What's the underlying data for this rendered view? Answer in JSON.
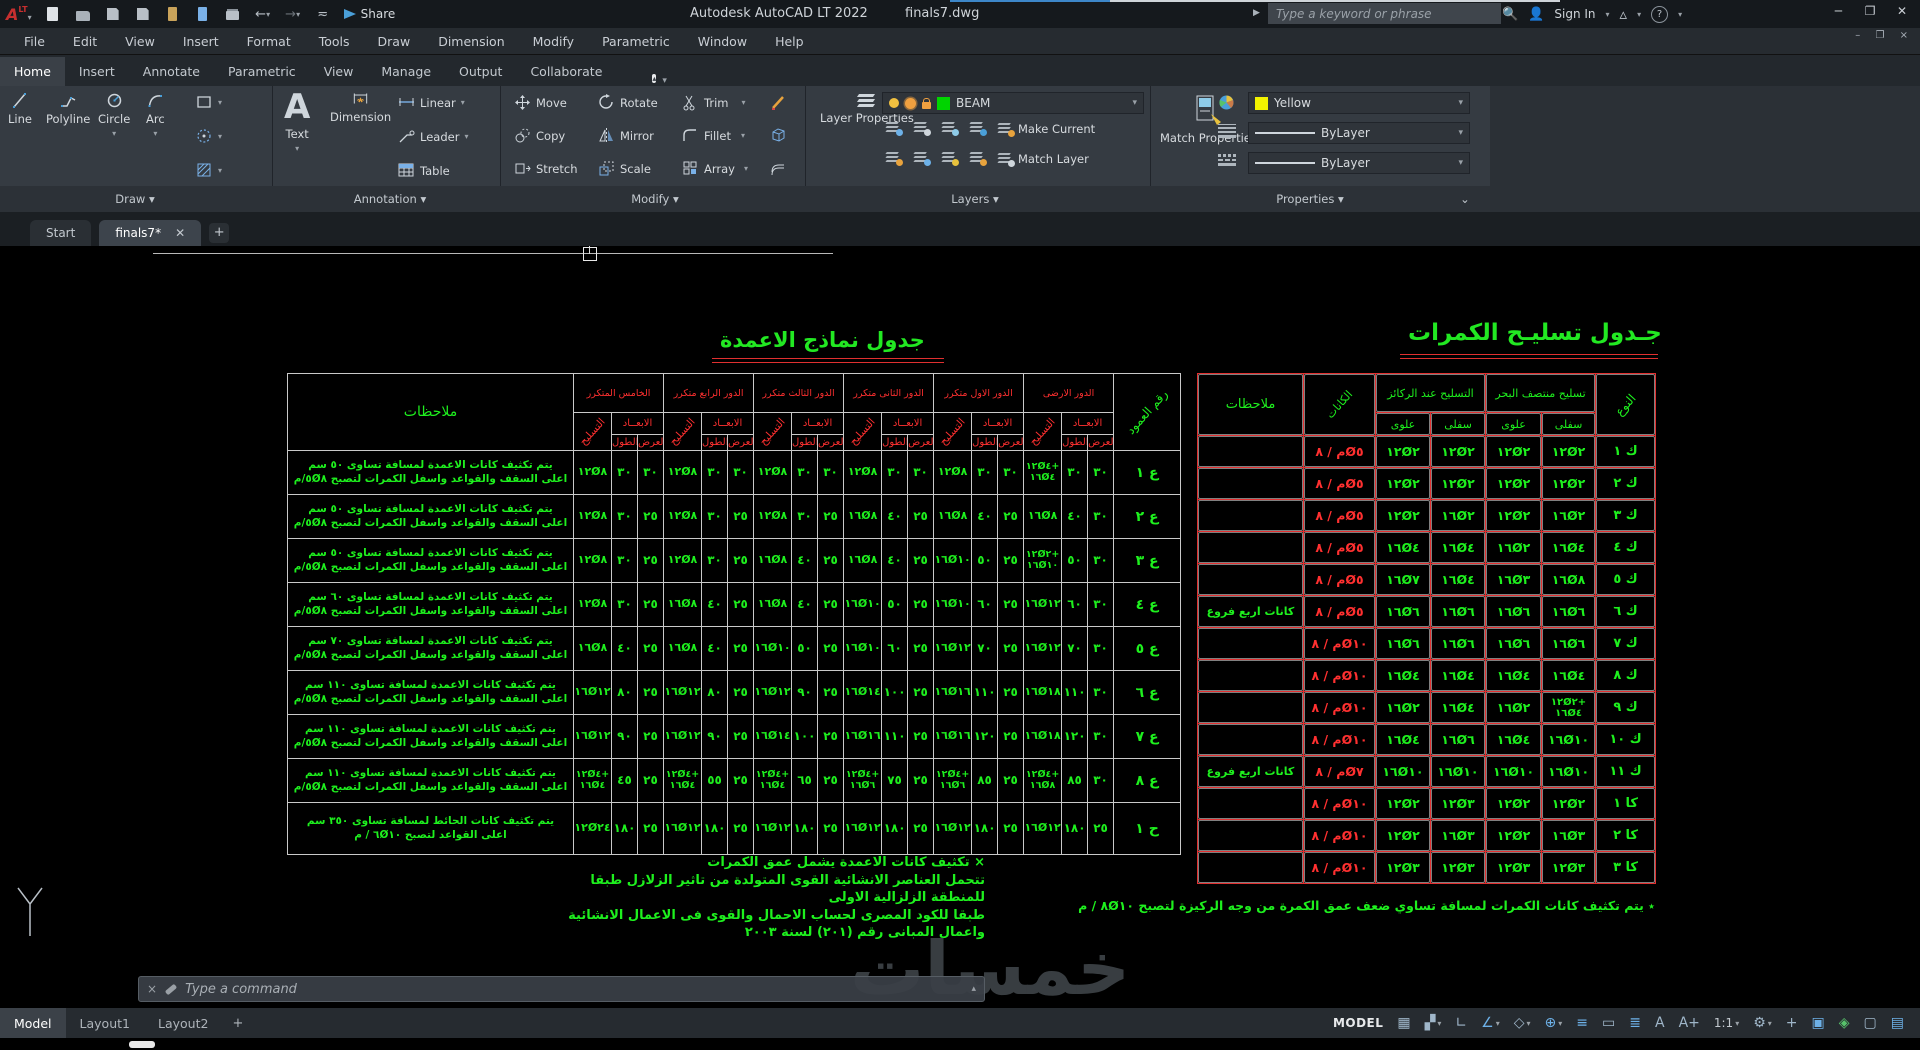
{
  "app": {
    "title": "Autodesk AutoCAD LT 2022",
    "file": "finals7.dwg",
    "share": "Share",
    "search_placeholder": "Type a keyword or phrase",
    "sign_in": "Sign In",
    "logo": "A",
    "logo_lt": "LT"
  },
  "menu": [
    "File",
    "Edit",
    "View",
    "Insert",
    "Format",
    "Tools",
    "Draw",
    "Dimension",
    "Modify",
    "Parametric",
    "Window",
    "Help"
  ],
  "ribbon_tabs": [
    {
      "label": "Home",
      "active": true
    },
    {
      "label": "Insert",
      "active": false
    },
    {
      "label": "Annotate",
      "active": false
    },
    {
      "label": "Parametric",
      "active": false
    },
    {
      "label": "View",
      "active": false
    },
    {
      "label": "Manage",
      "active": false
    },
    {
      "label": "Output",
      "active": false
    },
    {
      "label": "Collaborate",
      "active": false
    }
  ],
  "panels": {
    "draw": {
      "label": "Draw",
      "line": "Line",
      "polyline": "Polyline",
      "circle": "Circle",
      "arc": "Arc"
    },
    "annotation": {
      "label": "Annotation",
      "text": "Text",
      "dimension": "Dimension",
      "linear": "Linear",
      "leader": "Leader",
      "table": "Table"
    },
    "modify": {
      "label": "Modify",
      "move": "Move",
      "rotate": "Rotate",
      "trim": "Trim",
      "copy": "Copy",
      "mirror": "Mirror",
      "fillet": "Fillet",
      "stretch": "Stretch",
      "scale": "Scale",
      "array": "Array"
    },
    "layers": {
      "label": "Layers",
      "layer_properties": "Layer Properties",
      "layer_name": "BEAM",
      "layer_color": "#00d400",
      "make_current": "Make Current",
      "match_layer": "Match Layer"
    },
    "properties": {
      "label": "Properties",
      "match_properties": "Match Properties",
      "color_name": "Yellow",
      "color_hex": "#f2f200",
      "lineweight": "ByLayer",
      "linetype": "ByLayer"
    }
  },
  "file_tabs": [
    {
      "label": "Start",
      "active": false,
      "closable": false
    },
    {
      "label": "finals7*",
      "active": true,
      "closable": true
    }
  ],
  "new_tab_label": "+",
  "left_table": {
    "title": "جدول نماذج الاعمدة",
    "headers": {
      "notes": "ملاحظات",
      "col_no": "رقم العمود",
      "dims": "الابعــاد",
      "length": "الطول",
      "width": "العرض",
      "reinf": "التسليح",
      "floors": [
        "الدور الارضى",
        "الدور الاول متكرر",
        "الدور الثانى متكرر",
        "الدور الثالث متكرر",
        "الدور الرابع متكرر",
        "الخامس المتكرر"
      ]
    },
    "rows": [
      {
        "id": "ع ١",
        "floors": [
          {
            "w": "٣٠",
            "l": "٣٠",
            "r": "١٢Ø٤+|١٦Ø٤"
          },
          {
            "w": "٣٠",
            "l": "٣٠",
            "r": "١٢Ø٨"
          },
          {
            "w": "٣٠",
            "l": "٣٠",
            "r": "١٢Ø٨"
          },
          {
            "w": "٣٠",
            "l": "٣٠",
            "r": "١٢Ø٨"
          },
          {
            "w": "٣٠",
            "l": "٣٠",
            "r": "١٢Ø٨"
          },
          {
            "w": "٣٠",
            "l": "٣٠",
            "r": "١٢Ø٨"
          }
        ],
        "note": [
          "يتم تكثيف كانات الاعمدة لمسافة تساوى ٥٠ سم",
          "اعلى السقف والقواعد واسفل الكمرات لتصبح ٥Ø٨/م"
        ]
      },
      {
        "id": "ع ٢",
        "floors": [
          {
            "w": "٣٠",
            "l": "٤٠",
            "r": "١٦Ø٨"
          },
          {
            "w": "٢٥",
            "l": "٤٠",
            "r": "١٦Ø٨"
          },
          {
            "w": "٢٥",
            "l": "٤٠",
            "r": "١٦Ø٨"
          },
          {
            "w": "٢٥",
            "l": "٣٠",
            "r": "١٢Ø٨"
          },
          {
            "w": "٢٥",
            "l": "٣٠",
            "r": "١٢Ø٨"
          },
          {
            "w": "٢٥",
            "l": "٣٠",
            "r": "١٢Ø٨"
          }
        ],
        "note": [
          "يتم تكثيف كانات الاعمدة لمسافة تساوى ٥٠ سم",
          "اعلى السقف والقواعد واسفل الكمرات لتصبح ٥Ø٨/م"
        ]
      },
      {
        "id": "ع ٣",
        "floors": [
          {
            "w": "٣٠",
            "l": "٥٠",
            "r": "١٢Ø٢+|١٦Ø١٠"
          },
          {
            "w": "٢٥",
            "l": "٥٠",
            "r": "١٦Ø١٠"
          },
          {
            "w": "٢٥",
            "l": "٤٠",
            "r": "١٦Ø٨"
          },
          {
            "w": "٢٥",
            "l": "٤٠",
            "r": "١٦Ø٨"
          },
          {
            "w": "٢٥",
            "l": "٣٠",
            "r": "١٢Ø٨"
          },
          {
            "w": "٢٥",
            "l": "٣٠",
            "r": "١٢Ø٨"
          }
        ],
        "note": [
          "يتم تكثيف كانات الاعمدة لمسافة تساوى ٥٠ سم",
          "اعلى السقف والقواعد واسفل الكمرات لتصبح ٥Ø٨/م"
        ]
      },
      {
        "id": "ع ٤",
        "floors": [
          {
            "w": "٣٠",
            "l": "٦٠",
            "r": "١٦Ø١٢"
          },
          {
            "w": "٢٥",
            "l": "٦٠",
            "r": "١٦Ø١٠"
          },
          {
            "w": "٢٥",
            "l": "٥٠",
            "r": "١٦Ø١٠"
          },
          {
            "w": "٢٥",
            "l": "٤٠",
            "r": "١٦Ø٨"
          },
          {
            "w": "٢٥",
            "l": "٤٠",
            "r": "١٦Ø٨"
          },
          {
            "w": "٢٥",
            "l": "٣٠",
            "r": "١٢Ø٨"
          }
        ],
        "note": [
          "يتم تكثيف كانات الاعمدة لمسافة تساوى ٦٠ سم",
          "اعلى السقف والقواعد واسفل الكمرات لتصبح ٥Ø٨/م"
        ]
      },
      {
        "id": "ع ٥",
        "floors": [
          {
            "w": "٣٠",
            "l": "٧٠",
            "r": "١٦Ø١٢"
          },
          {
            "w": "٢٥",
            "l": "٧٠",
            "r": "١٦Ø١٢"
          },
          {
            "w": "٢٥",
            "l": "٦٠",
            "r": "١٦Ø١٠"
          },
          {
            "w": "٢٥",
            "l": "٥٠",
            "r": "١٦Ø١٠"
          },
          {
            "w": "٢٥",
            "l": "٤٠",
            "r": "١٦Ø٨"
          },
          {
            "w": "٢٥",
            "l": "٤٠",
            "r": "١٦Ø٨"
          }
        ],
        "note": [
          "يتم تكثيف كانات الاعمدة لمسافة تساوى ٧٠ سم",
          "اعلى السقف والقواعد واسفل الكمرات لتصبح ٥Ø٨/م"
        ]
      },
      {
        "id": "ع ٦",
        "floors": [
          {
            "w": "٣٠",
            "l": "١١٠",
            "r": "١٦Ø١٨"
          },
          {
            "w": "٢٥",
            "l": "١١٠",
            "r": "١٦Ø١٦"
          },
          {
            "w": "٢٥",
            "l": "١٠٠",
            "r": "١٦Ø١٤"
          },
          {
            "w": "٢٥",
            "l": "٩٠",
            "r": "١٦Ø١٢"
          },
          {
            "w": "٢٥",
            "l": "٨٠",
            "r": "١٦Ø١٢"
          },
          {
            "w": "٢٥",
            "l": "٨٠",
            "r": "١٦Ø١٢"
          }
        ],
        "note": [
          "يتم تكثيف كانات الاعمدة لمسافة تساوى ١١٠ سم",
          "اعلى السقف والقواعد واسفل الكمرات لتصبح ٥Ø٨/م"
        ]
      },
      {
        "id": "ع ٧",
        "floors": [
          {
            "w": "٣٠",
            "l": "١٢٠",
            "r": "١٦Ø١٨"
          },
          {
            "w": "٢٥",
            "l": "١٢٠",
            "r": "١٦Ø١٦"
          },
          {
            "w": "٢٥",
            "l": "١١٠",
            "r": "١٦Ø١٦"
          },
          {
            "w": "٢٥",
            "l": "١٠٠",
            "r": "١٦Ø١٤"
          },
          {
            "w": "٢٥",
            "l": "٩٠",
            "r": "١٦Ø١٢"
          },
          {
            "w": "٢٥",
            "l": "٩٠",
            "r": "١٦Ø١٢"
          }
        ],
        "note": [
          "يتم تكثيف كانات الاعمدة لمسافة تساوى ١١٠ سم",
          "اعلى السقف والقواعد واسفل الكمرات لتصبح ٥Ø٨/م"
        ]
      },
      {
        "id": "ع ٨",
        "floors": [
          {
            "w": "٣٠",
            "l": "٨٥",
            "r": "١٢Ø٤+|١٦Ø٨"
          },
          {
            "w": "٢٥",
            "l": "٨٥",
            "r": "١٢Ø٤+|١٦Ø٦"
          },
          {
            "w": "٢٥",
            "l": "٧٥",
            "r": "١٢Ø٤+|١٦Ø٦"
          },
          {
            "w": "٢٥",
            "l": "٦٥",
            "r": "١٢Ø٤+|١٦Ø٤"
          },
          {
            "w": "٢٥",
            "l": "٥٥",
            "r": "١٢Ø٤+|١٦Ø٤"
          },
          {
            "w": "٢٥",
            "l": "٤٥",
            "r": "١٢Ø٤+|١٦Ø٤"
          }
        ],
        "note": [
          "يتم تكثيف كانات الاعمدة لمسافة تساوى ١١٠ سم",
          "اعلى السقف والقواعد واسفل الكمرات لتصبح ٥Ø٨/م"
        ]
      },
      {
        "id": "ح ١",
        "floors": [
          {
            "w": "٢٥",
            "l": "١٨٠",
            "r": "١٦Ø١٢"
          },
          {
            "w": "٢٥",
            "l": "١٨٠",
            "r": "١٦Ø١٢"
          },
          {
            "w": "٢٥",
            "l": "١٨٠",
            "r": "١٦Ø١٢"
          },
          {
            "w": "٢٥",
            "l": "١٨٠",
            "r": "١٦Ø١٢"
          },
          {
            "w": "٢٥",
            "l": "١٨٠",
            "r": "١٦Ø١٢"
          },
          {
            "w": "٢٥",
            "l": "١٨٠",
            "r": "١٢Ø٢٤"
          }
        ],
        "note": [
          "يتم تكثيف كانات الحائط لمسافة تساوى ٣٥٠ سم",
          "اعلى القواعد لتصبح ٦Ø١٠ / م"
        ]
      }
    ],
    "footnotes": [
      "× تكثيف كانات الاعمدة يشمل عمق الكمرات",
      "تتحمل العناصر الانشائية القوى المتولدة من تاثير الزلازل طبقا للمنطقة الزلزالية الاولى",
      "طبقا للكود المصرى لحساب الاحمال والقوى فى الاعمال الانشائية واعمال المبانى رقم (٢٠١) لسنة ٢٠٠٣"
    ]
  },
  "right_table": {
    "title": "جـدول تسليـح الكمرات",
    "headers": {
      "type": "النوع",
      "mid_group": "تسليح منتصف البحر",
      "support_group": "التسليح عند الركائز",
      "top": "علوى",
      "bottom": "سفلى",
      "stirrups": "الكانات",
      "notes": "ملاحظات"
    },
    "rows": [
      {
        "type": "ك ١",
        "sup_t": "١٢Ø٢",
        "sup_b": "١٢Ø٢",
        "mid_t": "١٢Ø٢",
        "mid_b": "١٢Ø٢",
        "st": "م / ٨Ø٥",
        "note": ""
      },
      {
        "type": "ك ٢",
        "sup_t": "١٢Ø٢",
        "sup_b": "١٢Ø٢",
        "mid_t": "١٢Ø٢",
        "mid_b": "١٢Ø٢",
        "st": "م / ٨Ø٥",
        "note": ""
      },
      {
        "type": "ك ٣",
        "sup_t": "١٢Ø٢",
        "sup_b": "١٦Ø٢",
        "mid_t": "١٢Ø٢",
        "mid_b": "١٦Ø٢",
        "st": "م / ٨Ø٥",
        "note": ""
      },
      {
        "type": "ك ٤",
        "sup_t": "١٦Ø٤",
        "sup_b": "١٦Ø٤",
        "mid_t": "١٦Ø٢",
        "mid_b": "١٦Ø٤",
        "st": "م / ٨Ø٥",
        "note": ""
      },
      {
        "type": "ك ٥",
        "sup_t": "١٦Ø٧",
        "sup_b": "١٦Ø٤",
        "mid_t": "١٦Ø٣",
        "mid_b": "١٦Ø٨",
        "st": "م / ٨Ø٥",
        "note": ""
      },
      {
        "type": "ك ٦",
        "sup_t": "١٦Ø٦",
        "sup_b": "١٦Ø٦",
        "mid_t": "١٦Ø٦",
        "mid_b": "١٦Ø٦",
        "st": "م / ٨Ø٥",
        "note": "كانات اربع فروع"
      },
      {
        "type": "ك ٧",
        "sup_t": "١٦Ø٦",
        "sup_b": "١٦Ø٦",
        "mid_t": "١٦Ø٦",
        "mid_b": "١٦Ø٦",
        "st": "م / ٨Ø١٠",
        "note": ""
      },
      {
        "type": "ك ٨",
        "sup_t": "١٦Ø٤",
        "sup_b": "١٦Ø٤",
        "mid_t": "١٦Ø٤",
        "mid_b": "١٦Ø٤",
        "st": "م / ٨Ø١٠",
        "note": ""
      },
      {
        "type": "ك ٩",
        "sup_t": "١٦Ø٢",
        "sup_b": "١٦Ø٤",
        "mid_t": "١٦Ø٢",
        "mid_b": "١٢Ø٢+|١٦Ø٤",
        "st": "م / ٨Ø١٠",
        "note": ""
      },
      {
        "type": "ك ١٠",
        "sup_t": "١٦Ø٤",
        "sup_b": "١٦Ø٦",
        "mid_t": "١٦Ø٤",
        "mid_b": "١٦Ø١٠",
        "st": "م / ٨Ø١٠",
        "note": ""
      },
      {
        "type": "ك ١١",
        "sup_t": "١٦Ø١٠",
        "sup_b": "١٦Ø١٠",
        "mid_t": "١٦Ø١٠",
        "mid_b": "١٦Ø١٠",
        "st": "م / ٨Ø٧",
        "note": "كانات اربع فروع"
      },
      {
        "type": "كا ١",
        "sup_t": "١٢Ø٢",
        "sup_b": "١٢Ø٣",
        "mid_t": "١٢Ø٢",
        "mid_b": "١٢Ø٢",
        "st": "م / ٨Ø١٠",
        "note": ""
      },
      {
        "type": "كا ٢",
        "sup_t": "١٢Ø٢",
        "sup_b": "١٦Ø٣",
        "mid_t": "١٢Ø٢",
        "mid_b": "١٦Ø٣",
        "st": "م / ٨Ø١٠",
        "note": ""
      },
      {
        "type": "كا ٣",
        "sup_t": "١٢Ø٣",
        "sup_b": "١٢Ø٣",
        "mid_t": "١٢Ø٣",
        "mid_b": "١٢Ø٣",
        "st": "م / ٨Ø١٠",
        "note": ""
      }
    ],
    "footnote": "٭ يتم تكثيف كانات الكمرات لمسافة تساوي ضعف عمق الكمرة من وجه الركيزة لتصبح ٨Ø١٠ / م"
  },
  "watermark": "خمسات",
  "command": {
    "placeholder": "Type a command"
  },
  "status": {
    "model_tabs": [
      {
        "label": "Model",
        "active": true
      },
      {
        "label": "Layout1",
        "active": false
      },
      {
        "label": "Layout2",
        "active": false
      }
    ],
    "new_layout_label": "+",
    "model_badge": "MODEL",
    "scale": "1:1",
    "icons": [
      {
        "name": "grid-icon",
        "glyph": "▦",
        "color": "#9fb6c9",
        "caret": false
      },
      {
        "name": "snap-mode-icon",
        "glyph": "▞",
        "color": "#9fb6c9",
        "caret": true
      },
      {
        "name": "ortho-icon",
        "glyph": "∟",
        "color": "#9fb6c9",
        "caret": false
      },
      {
        "name": "polar-tracking-icon",
        "glyph": "∠",
        "color": "#6db1e8",
        "caret": true
      },
      {
        "name": "isodraft-icon",
        "glyph": "◇",
        "color": "#9fb6c9",
        "caret": true
      },
      {
        "name": "object-snap-icon",
        "glyph": "⊕",
        "color": "#6db1e8",
        "caret": true
      },
      {
        "name": "lineweight-display-icon",
        "glyph": "≡",
        "color": "#6db1e8",
        "caret": false
      },
      {
        "name": "transparency-icon",
        "glyph": "▭",
        "color": "#9fb6c9",
        "caret": false
      },
      {
        "name": "selection-cycling-icon",
        "glyph": "≣",
        "color": "#6db1e8",
        "caret": false
      },
      {
        "name": "annotation-visibility-icon",
        "glyph": "A",
        "color": "#9fb6c9",
        "caret": false
      },
      {
        "name": "autoscale-icon",
        "glyph": "A+",
        "color": "#9fb6c9",
        "caret": false
      }
    ],
    "icons_after": [
      {
        "name": "workspace-gear-icon",
        "glyph": "⚙",
        "color": "#9fb6c9",
        "caret": true
      },
      {
        "name": "annotation-monitor-icon",
        "glyph": "+",
        "color": "#9fb6c9",
        "caret": false
      },
      {
        "name": "graphics-performance-icon",
        "glyph": "▣",
        "color": "#6db1e8",
        "caret": false
      },
      {
        "name": "security-icon",
        "glyph": "◈",
        "color": "#57c26b",
        "caret": false
      },
      {
        "name": "isolate-objects-icon",
        "glyph": "▢",
        "color": "#9fb6c9",
        "caret": false
      },
      {
        "name": "clean-screen-icon",
        "glyph": "▤",
        "color": "#6db1e8",
        "caret": false
      }
    ]
  }
}
